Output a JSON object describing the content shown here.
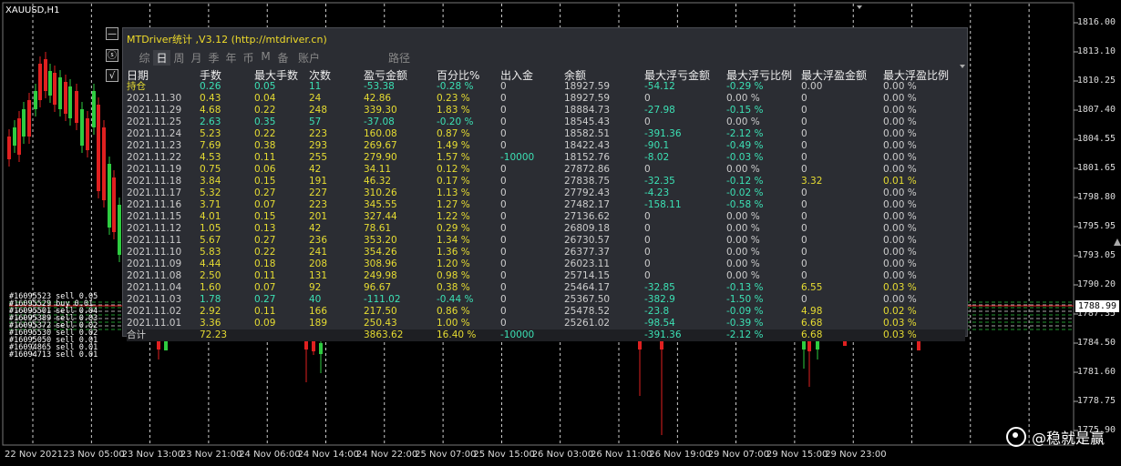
{
  "chart": {
    "symbol": "XAUUSD,H1",
    "price_labels": [
      "1816.00",
      "1813.10",
      "1810.25",
      "1807.40",
      "1804.55",
      "1801.65",
      "1798.80",
      "1795.95",
      "1793.05",
      "1790.20",
      "1787.35",
      "1784.50",
      "1781.60",
      "1778.75",
      "1775.90"
    ],
    "current_price": "1788.99",
    "time_labels": [
      "22 Nov 2021",
      "23 Nov 05:00",
      "23 Nov 13:00",
      "23 Nov 21:00",
      "24 Nov 06:00",
      "24 Nov 14:00",
      "24 Nov 22:00",
      "25 Nov 07:00",
      "25 Nov 15:00",
      "26 Nov 03:00",
      "26 Nov 11:00",
      "26 Nov 19:00",
      "29 Nov 07:00",
      "29 Nov 15:00",
      "29 Nov 23:00"
    ],
    "order_lines": [
      "#16095523 sell 0.05",
      "#16095529 buy 0.01",
      "#16095501 sell 0.04",
      "#16095389 sell 0.03",
      "#16095372 sell 0.02",
      "#16095530 sell 0.02",
      "#16095050 sell 0.01",
      "#16094865 sell 0.01",
      "#16094713 sell 0.01"
    ],
    "watermark": "@稳就是赢",
    "colors": {
      "bull": "#2ecc40",
      "bear": "#e02020",
      "grid": "#ffffff"
    }
  },
  "panel": {
    "min_button": "—",
    "restore_button": "ⓢ",
    "collapse_button": "√",
    "title": "MTDriver统计 ,V3.12 (http://mtdriver.cn)",
    "tabs": [
      {
        "label": "综",
        "active": false
      },
      {
        "label": "日",
        "active": true
      },
      {
        "label": "周",
        "active": false
      },
      {
        "label": "月",
        "active": false
      },
      {
        "label": "季",
        "active": false
      },
      {
        "label": "年",
        "active": false
      },
      {
        "label": "币",
        "active": false
      },
      {
        "label": "M",
        "active": false
      },
      {
        "label": "备",
        "active": false
      },
      {
        "label": "账户",
        "active": false
      },
      {
        "label": "路径",
        "active": false
      }
    ],
    "headers": [
      "日期",
      "手数",
      "最大手数",
      "次数",
      "盈亏金额",
      "百分比%",
      "出入金",
      "余额",
      "最大浮亏金额",
      "最大浮亏比例",
      "最大浮盈金额",
      "最大浮盈比例"
    ],
    "rows": [
      {
        "cells": [
          "持仓",
          "0.26",
          "0.05",
          "11",
          "-53.38",
          "-0.28 %",
          "0",
          "18927.59",
          "-54.12",
          "-0.29 %",
          "0.00",
          "0.00 %"
        ],
        "color": "g",
        "first": "w"
      },
      {
        "cells": [
          "2021.11.30",
          "0.43",
          "0.04",
          "24",
          "42.86",
          "0.23 %",
          "0",
          "18927.59",
          "0",
          "0.00 %",
          "0",
          "0.00 %"
        ],
        "color": "y",
        "first": "w"
      },
      {
        "cells": [
          "2021.11.29",
          "4.68",
          "0.22",
          "248",
          "339.30",
          "1.83 %",
          "0",
          "18884.73",
          "-27.98",
          "-0.15 %",
          "0",
          "0.00 %"
        ],
        "color": "y",
        "first": "w"
      },
      {
        "cells": [
          "2021.11.25",
          "2.63",
          "0.35",
          "57",
          "-37.08",
          "-0.20 %",
          "0",
          "18545.43",
          "0",
          "0.00 %",
          "0",
          "0.00 %"
        ],
        "color": "g",
        "first": "w"
      },
      {
        "cells": [
          "2021.11.24",
          "5.23",
          "0.22",
          "223",
          "160.08",
          "0.87 %",
          "0",
          "18582.51",
          "-391.36",
          "-2.12 %",
          "0",
          "0.00 %"
        ],
        "color": "y",
        "first": "w"
      },
      {
        "cells": [
          "2021.11.23",
          "7.69",
          "0.38",
          "293",
          "269.67",
          "1.49 %",
          "0",
          "18422.43",
          "-90.1",
          "-0.49 %",
          "0",
          "0.00 %"
        ],
        "color": "y",
        "first": "w"
      },
      {
        "cells": [
          "2021.11.22",
          "4.53",
          "0.11",
          "255",
          "279.90",
          "1.57 %",
          "-10000",
          "18152.76",
          "-8.02",
          "-0.03 %",
          "0",
          "0.00 %"
        ],
        "color": "y",
        "first": "w"
      },
      {
        "cells": [
          "2021.11.19",
          "0.75",
          "0.06",
          "42",
          "34.11",
          "0.12 %",
          "0",
          "27872.86",
          "0",
          "0.00 %",
          "0",
          "0.00 %"
        ],
        "color": "y",
        "first": "w"
      },
      {
        "cells": [
          "2021.11.18",
          "3.84",
          "0.15",
          "191",
          "46.32",
          "0.17 %",
          "0",
          "27838.75",
          "-32.35",
          "-0.12 %",
          "3.32",
          "0.01 %"
        ],
        "color": "y",
        "first": "w"
      },
      {
        "cells": [
          "2021.11.17",
          "5.32",
          "0.27",
          "227",
          "310.26",
          "1.13 %",
          "0",
          "27792.43",
          "-4.23",
          "-0.02 %",
          "0",
          "0.00 %"
        ],
        "color": "y",
        "first": "w"
      },
      {
        "cells": [
          "2021.11.16",
          "3.71",
          "0.07",
          "223",
          "345.55",
          "1.27 %",
          "0",
          "27482.17",
          "-158.11",
          "-0.58 %",
          "0",
          "0.00 %"
        ],
        "color": "y",
        "first": "w"
      },
      {
        "cells": [
          "2021.11.15",
          "4.01",
          "0.15",
          "201",
          "327.44",
          "1.22 %",
          "0",
          "27136.62",
          "0",
          "0.00 %",
          "0",
          "0.00 %"
        ],
        "color": "y",
        "first": "w"
      },
      {
        "cells": [
          "2021.11.12",
          "1.05",
          "0.13",
          "42",
          "78.61",
          "0.29 %",
          "0",
          "26809.18",
          "0",
          "0.00 %",
          "0",
          "0.00 %"
        ],
        "color": "y",
        "first": "w"
      },
      {
        "cells": [
          "2021.11.11",
          "5.67",
          "0.27",
          "236",
          "353.20",
          "1.34 %",
          "0",
          "26730.57",
          "0",
          "0.00 %",
          "0",
          "0.00 %"
        ],
        "color": "y",
        "first": "w"
      },
      {
        "cells": [
          "2021.11.10",
          "5.83",
          "0.22",
          "241",
          "354.26",
          "1.36 %",
          "0",
          "26377.37",
          "0",
          "0.00 %",
          "0",
          "0.00 %"
        ],
        "color": "y",
        "first": "w"
      },
      {
        "cells": [
          "2021.11.09",
          "4.44",
          "0.18",
          "208",
          "308.96",
          "1.20 %",
          "0",
          "26023.11",
          "0",
          "0.00 %",
          "0",
          "0.00 %"
        ],
        "color": "y",
        "first": "w"
      },
      {
        "cells": [
          "2021.11.08",
          "2.50",
          "0.11",
          "131",
          "249.98",
          "0.98 %",
          "0",
          "25714.15",
          "0",
          "0.00 %",
          "0",
          "0.00 %"
        ],
        "color": "y",
        "first": "w"
      },
      {
        "cells": [
          "2021.11.04",
          "1.60",
          "0.07",
          "92",
          "96.67",
          "0.38 %",
          "0",
          "25464.17",
          "-32.85",
          "-0.13 %",
          "6.55",
          "0.03 %"
        ],
        "color": "y",
        "first": "w"
      },
      {
        "cells": [
          "2021.11.03",
          "1.78",
          "0.27",
          "40",
          "-111.02",
          "-0.44 %",
          "0",
          "25367.50",
          "-382.9",
          "-1.50 %",
          "0",
          "0.00 %"
        ],
        "color": "g",
        "first": "w"
      },
      {
        "cells": [
          "2021.11.02",
          "2.92",
          "0.11",
          "166",
          "217.50",
          "0.86 %",
          "0",
          "25478.52",
          "-23.8",
          "-0.09 %",
          "4.98",
          "0.02 %"
        ],
        "color": "y",
        "first": "w"
      },
      {
        "cells": [
          "2021.11.01",
          "3.36",
          "0.09",
          "189",
          "250.43",
          "1.00 %",
          "0",
          "25261.02",
          "-98.54",
          "-0.39 %",
          "6.68",
          "0.03 %"
        ],
        "color": "y",
        "first": "w"
      }
    ],
    "summary": {
      "cells": [
        "合计",
        "72.23",
        "",
        "",
        "3863.62",
        "16.40 %",
        "-10000",
        "",
        "-391.36",
        "-2.12 %",
        "6.68",
        "0.03 %"
      ]
    }
  }
}
